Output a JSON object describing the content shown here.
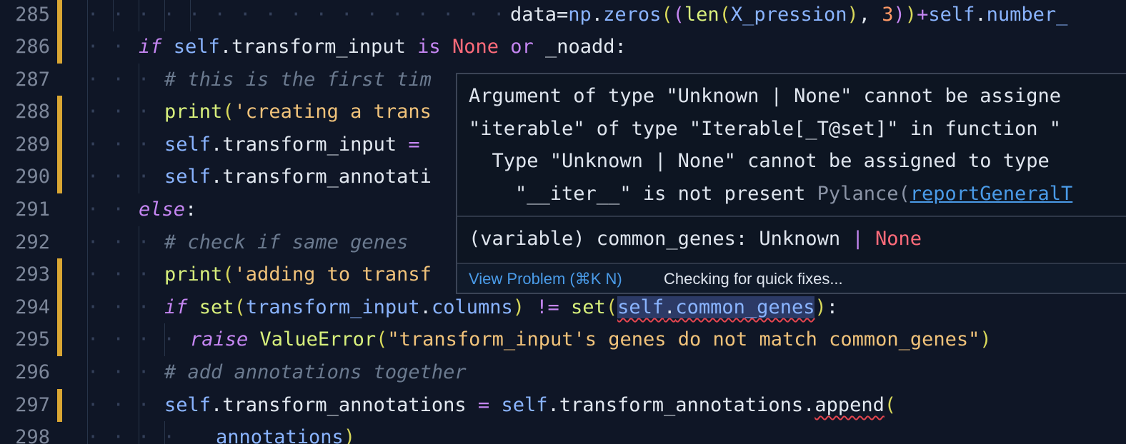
{
  "editor": {
    "lines": [
      {
        "number": "285",
        "modified": true,
        "dots": "· · · · · · · · · · · · · · · · ·",
        "indent_guides": 6,
        "code": "data=np.zeros((len(X_pression), 3))+self.number_"
      },
      {
        "number": "286",
        "modified": true,
        "dots": "· ·",
        "indent_guides": 1,
        "code": "if self.transform_input is None or _noadd:"
      },
      {
        "number": "287",
        "modified": false,
        "dots": "· · ·",
        "indent_guides": 2,
        "code": "# this is the first tim"
      },
      {
        "number": "288",
        "modified": true,
        "dots": "· · ·",
        "indent_guides": 2,
        "code": "print('creating a trans"
      },
      {
        "number": "289",
        "modified": true,
        "dots": "· · ·",
        "indent_guides": 2,
        "code": "self.transform_input = "
      },
      {
        "number": "290",
        "modified": true,
        "dots": "· · ·",
        "indent_guides": 2,
        "code": "self.transform_annotati"
      },
      {
        "number": "291",
        "modified": false,
        "dots": "· ·",
        "indent_guides": 1,
        "code": "else:"
      },
      {
        "number": "292",
        "modified": false,
        "dots": "· · ·",
        "indent_guides": 2,
        "code": "# check if same genes"
      },
      {
        "number": "293",
        "modified": true,
        "dots": "· · ·",
        "indent_guides": 2,
        "code": "print('adding to transf"
      },
      {
        "number": "294",
        "modified": true,
        "dots": "· · ·",
        "indent_guides": 2,
        "code": "if set(transform_input.columns) != set(self.common_genes):"
      },
      {
        "number": "295",
        "modified": true,
        "dots": "· · · ·",
        "indent_guides": 3,
        "code": "raise ValueError(\"transform_input's genes do not match common_genes\")"
      },
      {
        "number": "296",
        "modified": false,
        "dots": "· · ·",
        "indent_guides": 2,
        "code": "# add annotations together"
      },
      {
        "number": "297",
        "modified": true,
        "dots": "· · ·",
        "indent_guides": 2,
        "code": "self.transform_annotations = self.transform_annotations.append("
      },
      {
        "number": "298",
        "modified": false,
        "dots": "· · · ·",
        "indent_guides": 3,
        "code": "annotations)"
      }
    ]
  },
  "hover": {
    "message_lines": [
      "Argument of type \"Unknown | None\" cannot be assigne",
      "\"iterable\" of type \"Iterable[_T@set]\" in function \"",
      "  Type \"Unknown | None\" cannot be assigned to type",
      "    \"__iter__\" is not present"
    ],
    "source": "Pylance",
    "rule_link": "reportGeneralT",
    "signature": {
      "prefix": "(variable) common_genes: Unknown ",
      "pipe": "|",
      "none": " None"
    },
    "actions": {
      "view_problem": "View Problem (⌘K N)",
      "quick_fix_status": "Checking for quick fixes..."
    }
  },
  "colors": {
    "background": "#0f1626",
    "modified_gutter": "#d9a633",
    "keyword": "#c586f2",
    "self": "#8ab4ff",
    "string": "#f0c27a",
    "comment": "#6b7a8f",
    "none": "#ff6b7a",
    "link": "#4a9be8"
  }
}
